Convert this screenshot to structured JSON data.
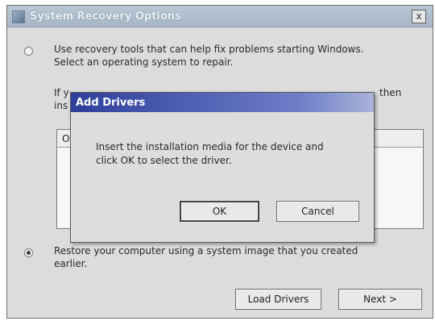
{
  "window": {
    "title": "System Recovery Options",
    "close_glyph": "x",
    "icon": "recovery-app-icon"
  },
  "option_repair": {
    "selected": false,
    "text": "Use recovery tools that can help fix problems starting Windows.\nSelect an operating system to repair.",
    "partial_line1_start": "If y",
    "partial_line1_end": "then",
    "partial_line2_start": "ins",
    "list_header": "O"
  },
  "option_restore": {
    "selected": true,
    "text": "Restore your computer using a system image that you created\nearlier."
  },
  "buttons": {
    "load_drivers": "Load Drivers",
    "next": "Next >"
  },
  "dialog": {
    "title": "Add Drivers",
    "message": "Insert the installation media for the device and\nclick OK to select the driver.",
    "ok": "OK",
    "cancel": "Cancel"
  }
}
